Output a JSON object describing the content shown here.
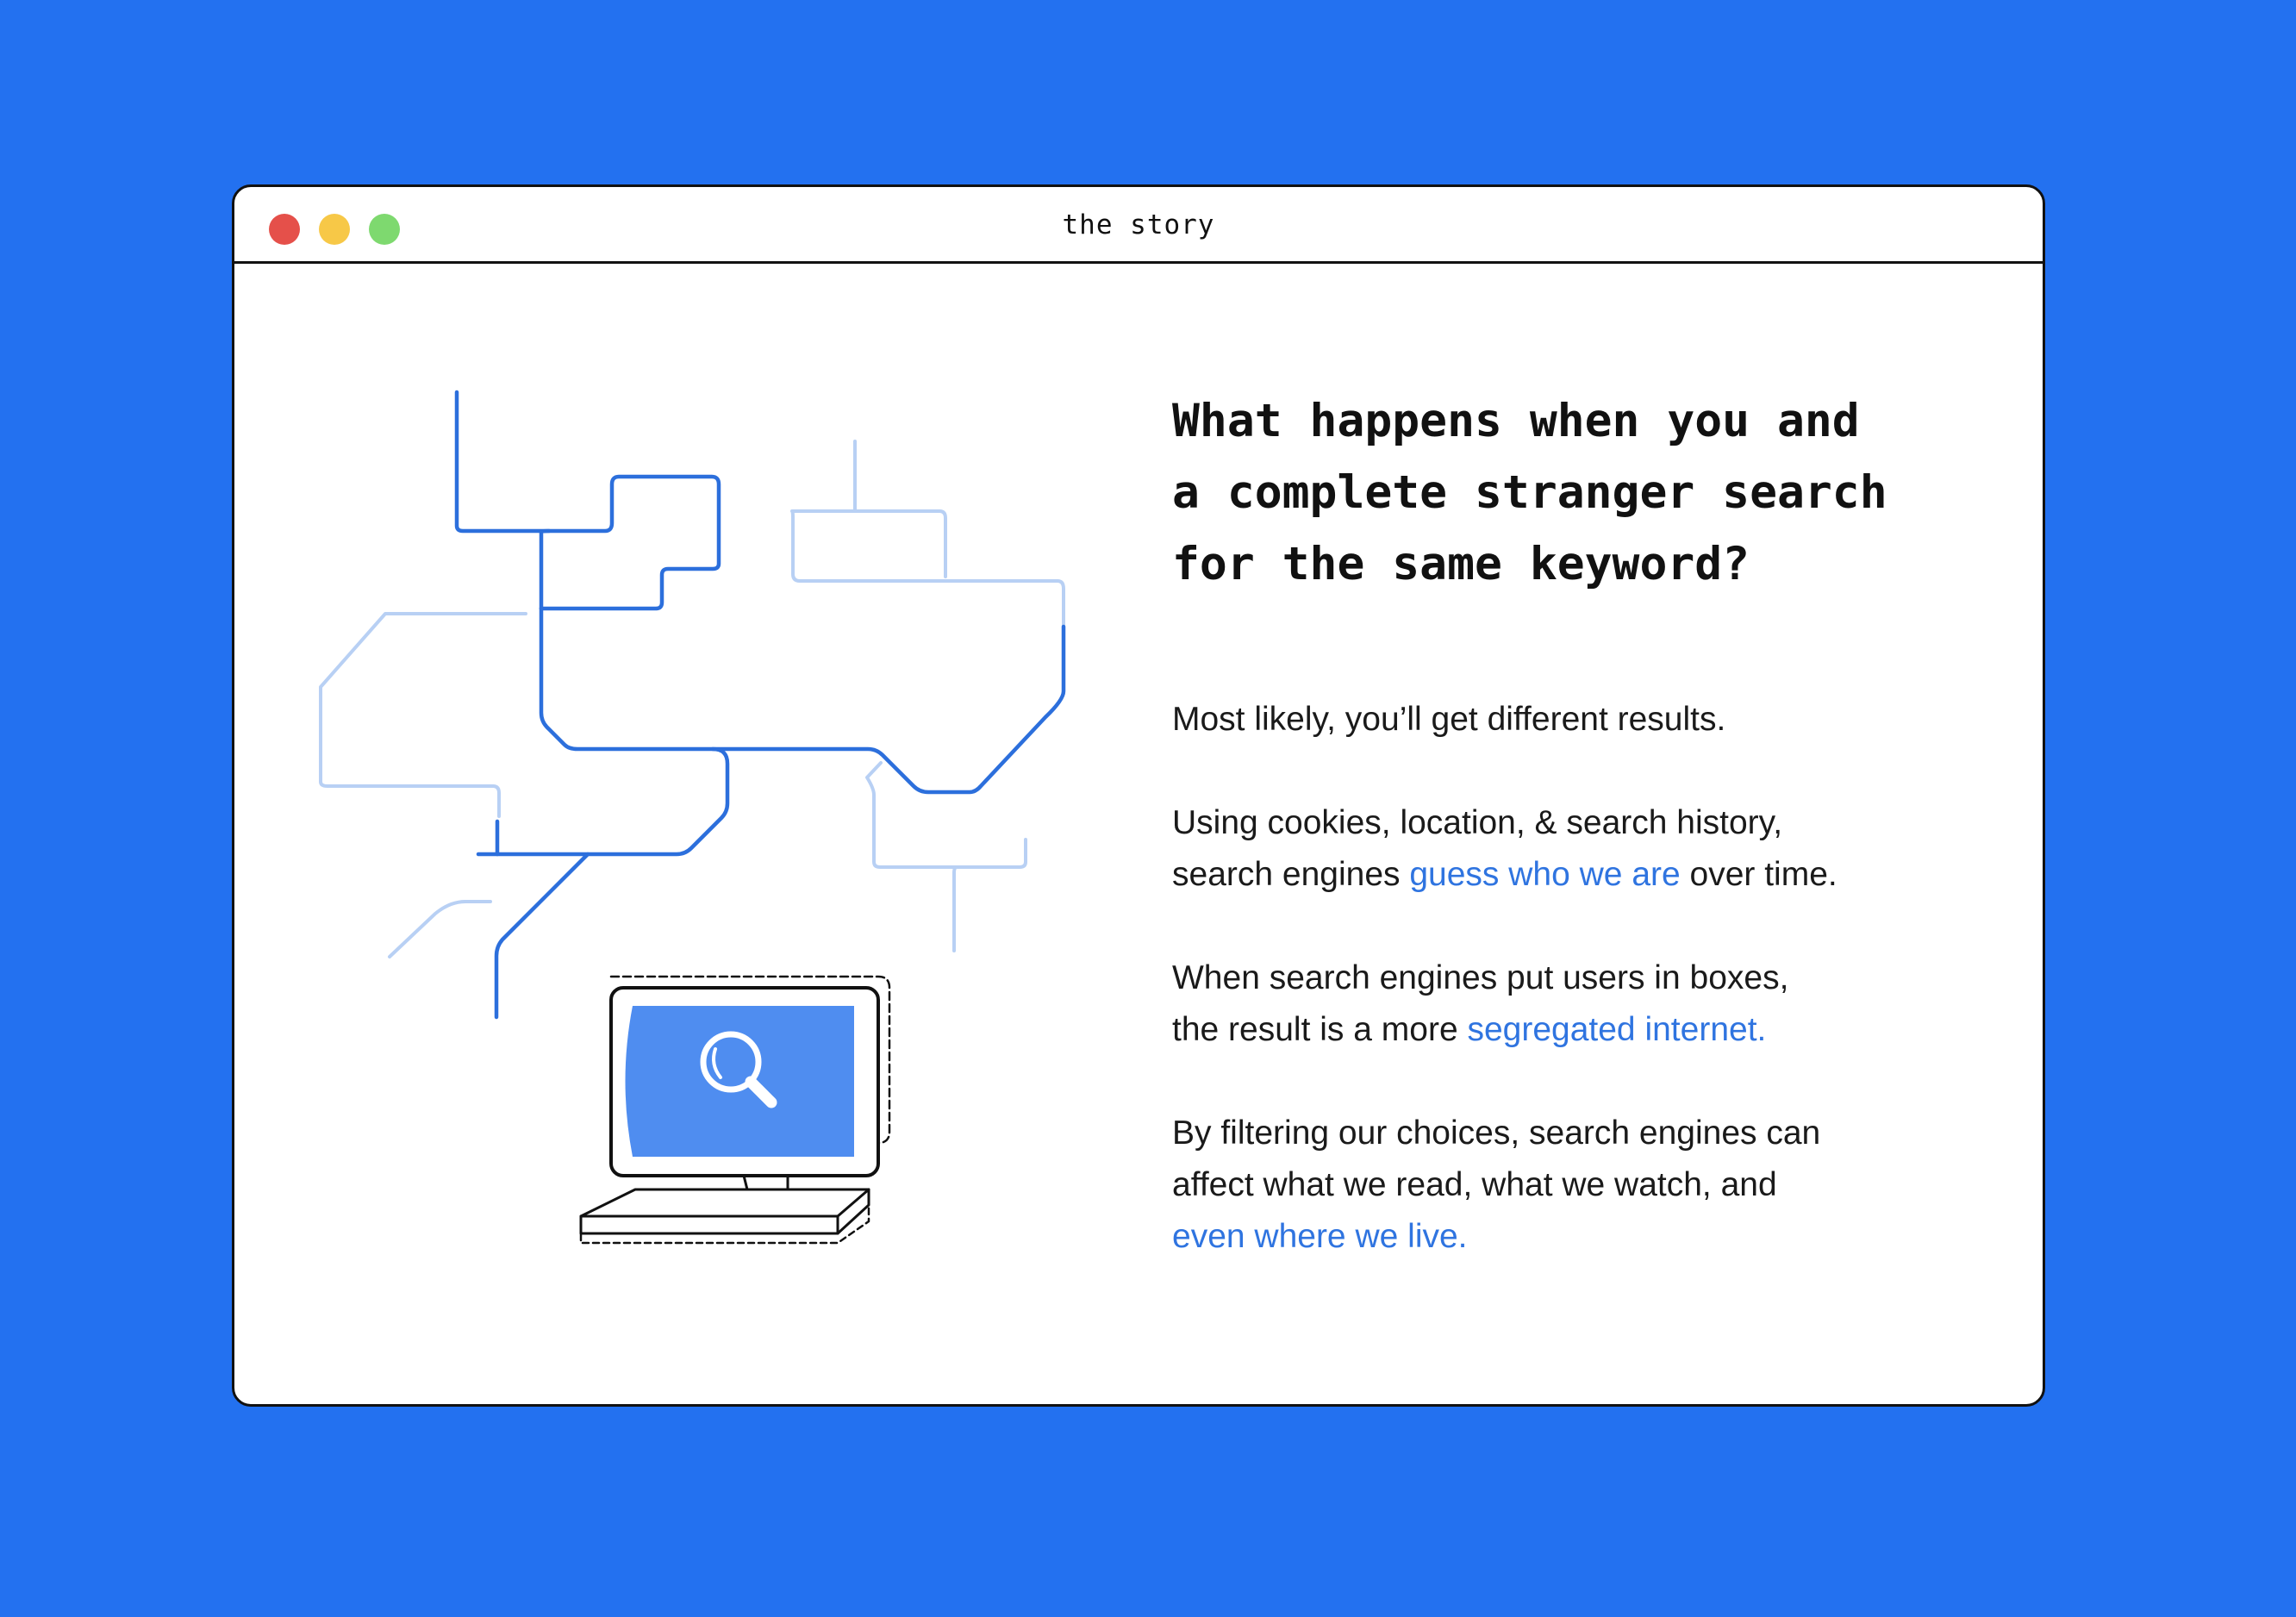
{
  "window": {
    "title": "the story",
    "controls": {
      "close_color": "#E5504A",
      "minimize_color": "#F7C847",
      "maximize_color": "#7ED96F"
    }
  },
  "colors": {
    "background": "#2371F0",
    "accent": "#2F74E0",
    "line_dark": "#2C6FDC",
    "line_light": "#B8D0F4",
    "screen_fill": "#4F8DF0"
  },
  "illustration": {
    "icon": "computer-search-icon",
    "screen_icon": "magnifier-icon"
  },
  "headline": {
    "line1": "What happens when you and",
    "line2": "a complete stranger search",
    "line3": "for the same keyword?"
  },
  "paragraphs": {
    "p1": "Most likely, you’ll get different results.",
    "p2_line1": "Using cookies, location, & search history,",
    "p2_line2_prefix": "search engines ",
    "p2_link": "guess who we are",
    "p2_line2_suffix": " over time.",
    "p3_line1": "When search engines put users in boxes,",
    "p3_line2_prefix": "the result is a more ",
    "p3_link": "segregated internet.",
    "p4_line1": "By filtering our choices, search engines can",
    "p4_line2": "affect what we read, what we watch, and",
    "p4_link": "even where we live."
  }
}
